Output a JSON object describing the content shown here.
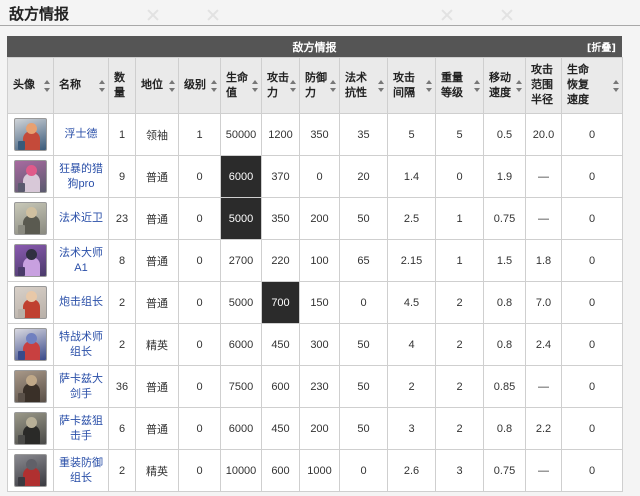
{
  "section_title": "敌方情报",
  "table": {
    "caption": "敌方情报",
    "collapse_label": "[折叠]",
    "headers": {
      "avatar": "头像",
      "name": "名称",
      "count": "数量",
      "status": "地位",
      "level": "级别",
      "hp": "生命值",
      "atk": "攻击力",
      "def": "防御力",
      "res": "法术抗性",
      "interval": "攻击间隔",
      "weight": "重量等级",
      "speed": "移动速度",
      "range": "攻击范围半径",
      "regen": "生命恢复速度"
    },
    "rows": [
      {
        "avatar_icon": "enemy-ice-wizard-icon",
        "colors": [
          "#3a5a7a",
          "#d0d4d8",
          "#c44a3a",
          "#e8a070"
        ],
        "name": "浮士德",
        "count": "1",
        "status": "领袖",
        "level": "1",
        "hp": "50000",
        "atk": "1200",
        "def": "350",
        "res": "35",
        "interval": "5",
        "weight": "5",
        "speed": "0.5",
        "range": "20.0",
        "regen": "0"
      },
      {
        "avatar_icon": "enemy-hound-icon",
        "colors": [
          "#5a5a6e",
          "#a86aa0",
          "#d8c8d8",
          "#e05a8a"
        ],
        "name": "狂暴的猎狗pro",
        "count": "9",
        "status": "普通",
        "level": "0",
        "hp": "6000",
        "atk": "370",
        "def": "0",
        "res": "20",
        "interval": "1.4",
        "weight": "0",
        "speed": "1.9",
        "range": "—",
        "regen": "0"
      },
      {
        "avatar_icon": "enemy-caster-guard-icon",
        "colors": [
          "#8a8a80",
          "#c8c8b8",
          "#5a5a50",
          "#d0c0a0"
        ],
        "name": "法术近卫",
        "count": "23",
        "status": "普通",
        "level": "0",
        "hp": "5000",
        "atk": "350",
        "def": "200",
        "res": "50",
        "interval": "2.5",
        "weight": "1",
        "speed": "0.75",
        "range": "—",
        "regen": "0"
      },
      {
        "avatar_icon": "enemy-caster-master-icon",
        "colors": [
          "#4a3a6a",
          "#8a5ab0",
          "#c8a0e0",
          "#303040"
        ],
        "name": "法术大师A1",
        "count": "8",
        "status": "普通",
        "level": "0",
        "hp": "2700",
        "atk": "220",
        "def": "100",
        "res": "65",
        "interval": "2.15",
        "weight": "1",
        "speed": "1.5",
        "range": "1.8",
        "regen": "0"
      },
      {
        "avatar_icon": "enemy-artillery-leader-icon",
        "colors": [
          "#b8b0a8",
          "#d8d0c8",
          "#c04030",
          "#e8c8a8"
        ],
        "name": "炮击组长",
        "count": "2",
        "status": "普通",
        "level": "0",
        "hp": "5000",
        "atk": "700",
        "def": "150",
        "res": "0",
        "interval": "4.5",
        "weight": "2",
        "speed": "0.8",
        "range": "7.0",
        "regen": "0"
      },
      {
        "avatar_icon": "enemy-special-caster-icon",
        "colors": [
          "#3a4a8a",
          "#d8d8e0",
          "#c84040",
          "#7080c0"
        ],
        "name": "特战术师组长",
        "count": "2",
        "status": "精英",
        "level": "0",
        "hp": "6000",
        "atk": "450",
        "def": "300",
        "res": "50",
        "interval": "4",
        "weight": "2",
        "speed": "0.8",
        "range": "2.4",
        "regen": "0"
      },
      {
        "avatar_icon": "enemy-sarkaz-greatsword-icon",
        "colors": [
          "#5a5048",
          "#a89888",
          "#3a3028",
          "#c0a888"
        ],
        "name": "萨卡兹大剑手",
        "count": "36",
        "status": "普通",
        "level": "0",
        "hp": "7500",
        "atk": "600",
        "def": "230",
        "res": "50",
        "interval": "2",
        "weight": "2",
        "speed": "0.85",
        "range": "—",
        "regen": "0"
      },
      {
        "avatar_icon": "enemy-sarkaz-sniper-icon",
        "colors": [
          "#4a4a48",
          "#9a9888",
          "#2a2a28",
          "#b8b098"
        ],
        "name": "萨卡兹狙击手",
        "count": "6",
        "status": "普通",
        "level": "0",
        "hp": "6000",
        "atk": "450",
        "def": "200",
        "res": "50",
        "interval": "3",
        "weight": "2",
        "speed": "0.8",
        "range": "2.2",
        "regen": "0"
      },
      {
        "avatar_icon": "enemy-heavy-defender-icon",
        "colors": [
          "#3a3a40",
          "#8a8a90",
          "#b03030",
          "#606068"
        ],
        "name": "重装防御组长",
        "count": "2",
        "status": "精英",
        "level": "0",
        "hp": "10000",
        "atk": "600",
        "def": "1000",
        "res": "0",
        "interval": "2.6",
        "weight": "3",
        "speed": "0.75",
        "range": "—",
        "regen": "0"
      }
    ],
    "highlighted_cells": [
      {
        "row": 1,
        "column": "hp"
      },
      {
        "row": 2,
        "column": "hp"
      },
      {
        "row": 4,
        "column": "atk"
      }
    ]
  }
}
